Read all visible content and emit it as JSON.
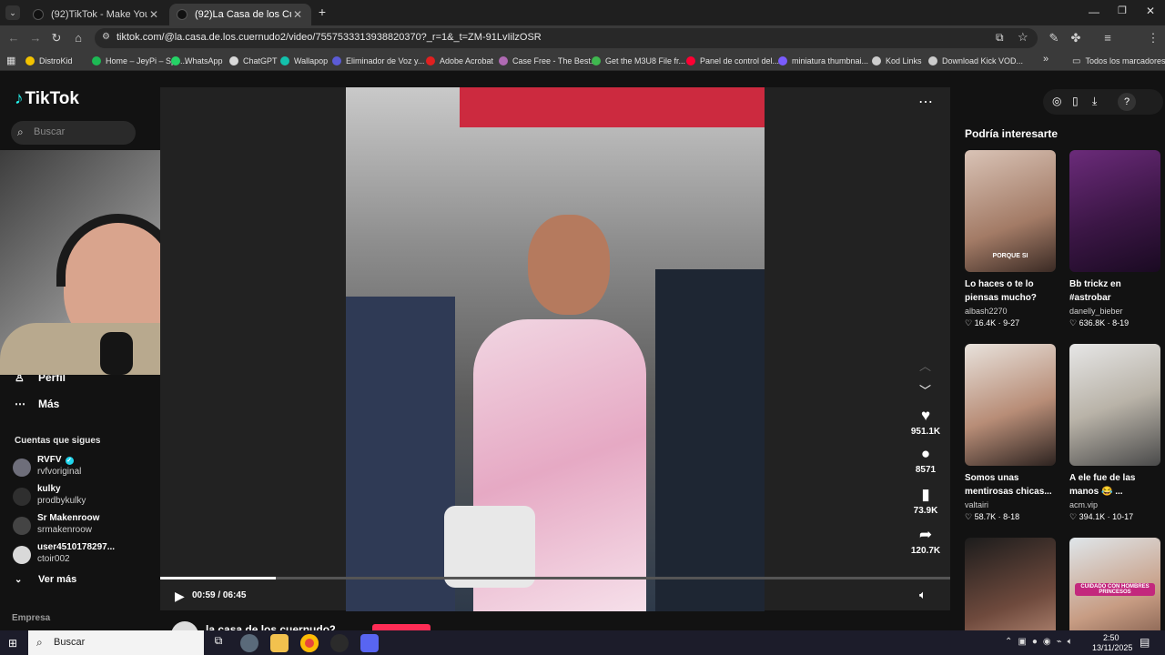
{
  "browser": {
    "tabs": [
      {
        "title": "(92)TikTok - Make Your Day",
        "close": "✕"
      },
      {
        "title": "(92)La Casa de los Cuernudos2",
        "close": "✕"
      }
    ],
    "new_tab": "+",
    "url": "tiktok.com/@la.casa.de.los.cuernudo2/video/7557533313938820370?_r=1&_t=ZM-91LvIilzOSR",
    "bookmarks": [
      {
        "label": "DistroKid",
        "color": "#f2c200"
      },
      {
        "label": "Home – JeyPi – Spo...",
        "color": "#1db954"
      },
      {
        "label": "WhatsApp",
        "color": "#25d366"
      },
      {
        "label": "ChatGPT",
        "color": "#d9d9d9"
      },
      {
        "label": "Wallapop",
        "color": "#13c1ac"
      },
      {
        "label": "Eliminador de Voz y...",
        "color": "#5b5bd6"
      },
      {
        "label": "Adobe Acrobat",
        "color": "#e02020"
      },
      {
        "label": "Case Free - The Best...",
        "color": "#b06ab3"
      },
      {
        "label": "Get the M3U8 File fr...",
        "color": "#3fb84f"
      },
      {
        "label": "Panel de control del...",
        "color": "#ff0033"
      },
      {
        "label": "miniatura thumbnai...",
        "color": "#7a5cff"
      },
      {
        "label": "Kod Links",
        "color": "#cccccc"
      },
      {
        "label": "Download Kick VOD...",
        "color": "#cccccc"
      }
    ],
    "bookmarks_more": "»",
    "all_bookmarks": "Todos los marcadores"
  },
  "tiktok": {
    "logo": "TikTok",
    "search_placeholder": "Buscar",
    "nav": {
      "profile": "Perfil",
      "more": "Más"
    },
    "following_title": "Cuentas que sigues",
    "following": [
      {
        "name": "RVFV",
        "handle": "rvfvoriginal",
        "verified": true
      },
      {
        "name": "kulky",
        "handle": "prodbykulky"
      },
      {
        "name": "Sr Makenroow",
        "handle": "srmakenroow"
      },
      {
        "name": "user4510178297...",
        "handle": "ctoir002"
      }
    ],
    "see_more": "Ver más",
    "company": "Empresa",
    "video": {
      "time": "00:59 / 06:45",
      "progress_fraction": 0.146,
      "creator": "la.casa.de.los.cuernudo2"
    },
    "actions": {
      "likes": "951.1K",
      "comments": "8571",
      "saves": "73.9K",
      "shares": "120.7K"
    },
    "suggest_title": "Podría interesarte",
    "suggestions": [
      {
        "title": "Lo haces o te lo piensas mucho?",
        "user": "albash2270",
        "stats": "♡ 16.4K · 9-27",
        "caption": "PORQUE SI"
      },
      {
        "title": "Bb trickz en #astrobar",
        "user": "danelly_bieber",
        "stats": "♡ 636.8K · 8-19",
        "caption": ""
      },
      {
        "title": "Somos unas mentirosas chicas...",
        "user": "valtairi",
        "stats": "♡ 58.7K · 8-18",
        "caption": ""
      },
      {
        "title": "A ele fue de las manos 😂 ...",
        "user": "acm.vip",
        "stats": "♡ 394.1K · 10-17",
        "caption": ""
      },
      {
        "title": "",
        "user": "",
        "stats": "",
        "caption": ""
      },
      {
        "title": "",
        "user": "",
        "stats": "",
        "caption": "CUIDADO CON HOMBRES PRINCESOS"
      }
    ]
  },
  "taskbar": {
    "search": "Buscar",
    "time": "2:50",
    "date": "13/11/2025"
  },
  "colors": {
    "accent": "#fe2c55",
    "bg": "#121212"
  }
}
